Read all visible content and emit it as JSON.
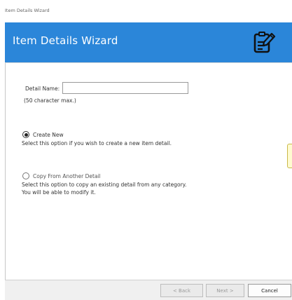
{
  "window": {
    "title": "Item Details Wizard"
  },
  "banner": {
    "title": "Item Details Wizard",
    "icon": "edit-document-icon",
    "color": "#2b86d9"
  },
  "form": {
    "detail_name_label": "Detail Name:",
    "detail_name_value": "",
    "detail_name_hint": "(50 character max.)"
  },
  "options": [
    {
      "label": "Create New",
      "selected": true,
      "description": "Select this option if you wish to create a new item detail."
    },
    {
      "label": "Copy From Another Detail",
      "selected": false,
      "description_line1": "Select this option to copy an existing detail from any category.",
      "description_line2": "You will be able to modify it."
    }
  ],
  "footer": {
    "back_label": "< Back",
    "next_label": "Next >",
    "cancel_label": "Cancel"
  }
}
